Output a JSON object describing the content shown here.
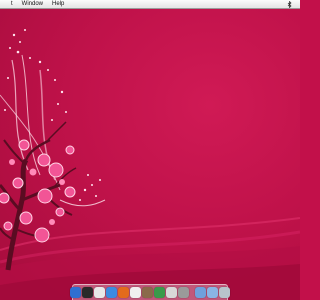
{
  "menubar": {
    "items": [
      {
        "label": "t"
      },
      {
        "label": "Window"
      },
      {
        "label": "Help"
      }
    ]
  },
  "dock": {
    "apps": [
      {
        "icon": "finder-icon",
        "color": "#2f6fd1"
      },
      {
        "icon": "dashboard-icon",
        "color": "#2a2a2a"
      },
      {
        "icon": "clock-icon",
        "color": "#e8e8e8"
      },
      {
        "icon": "safari-icon",
        "color": "#3b8be0"
      },
      {
        "icon": "firefox-icon",
        "color": "#e36b1c"
      },
      {
        "icon": "ical-icon",
        "color": "#f0f0f0"
      },
      {
        "icon": "preview-icon",
        "color": "#8a6a4a"
      },
      {
        "icon": "itunes-icon",
        "color": "#3a9a4a"
      },
      {
        "icon": "photo-icon",
        "color": "#d8d8d8"
      },
      {
        "icon": "system-preferences-icon",
        "color": "#9a9a9a"
      }
    ],
    "right": [
      {
        "icon": "applications-folder-icon",
        "color": "#6fa0dc"
      },
      {
        "icon": "documents-folder-icon",
        "color": "#8ab4e4"
      },
      {
        "icon": "trash-icon",
        "color": "#b8c4cc"
      }
    ]
  }
}
